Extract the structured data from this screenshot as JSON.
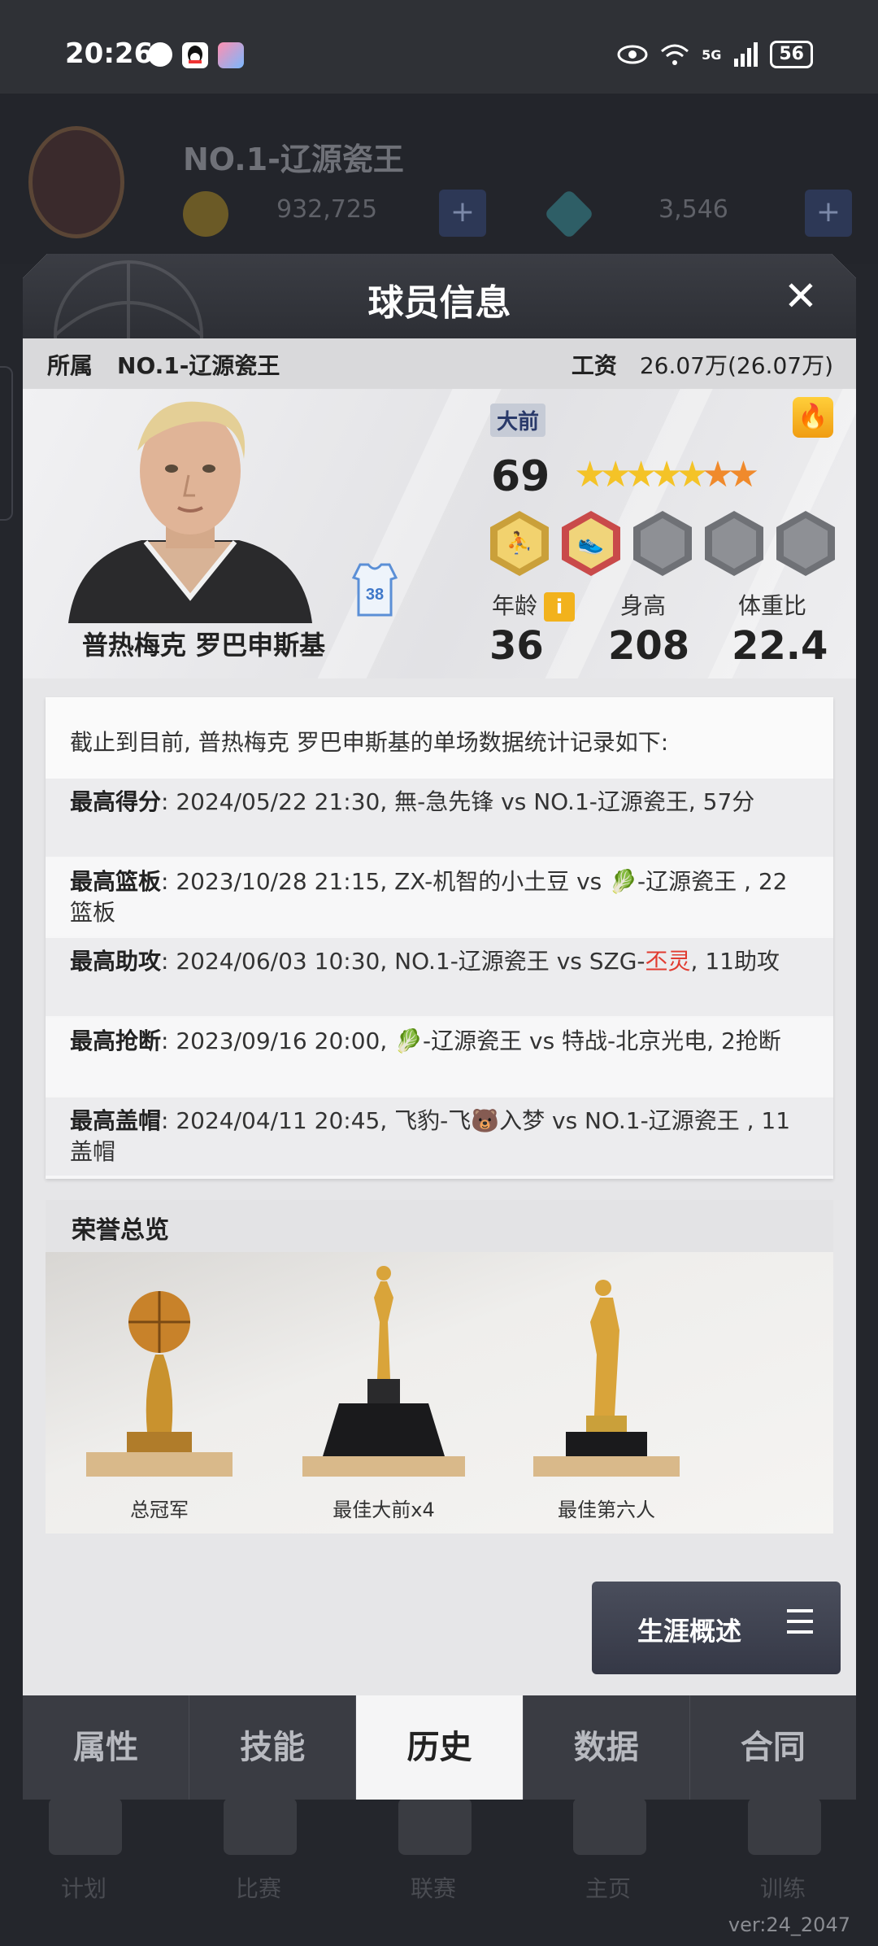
{
  "status_bar": {
    "time": "20:26",
    "network": "5G",
    "battery": "56"
  },
  "background": {
    "team_name": "NO.1-辽源瓷王",
    "coins": "932,725",
    "diamonds": "3,546",
    "version": "ver:24_2047",
    "bottom_labels": [
      "计划",
      "比赛",
      "联赛",
      "主页",
      "训练"
    ]
  },
  "modal": {
    "title": "球员信息",
    "close_icon": "close-icon",
    "affiliation_label": "所属",
    "affiliation_value": "NO.1-辽源瓷王",
    "salary_label": "工资",
    "salary_value": "26.07万(26.07万)"
  },
  "player": {
    "name": "普热梅克 罗巴申斯基",
    "jersey_number": "38",
    "position": "大前",
    "rating": "69",
    "star_count": 7,
    "star_colors": [
      "#f4c327",
      "#f4c327",
      "#f4c327",
      "#f4c327",
      "#f4c327",
      "#f08a2c",
      "#f08a2c"
    ],
    "age_label": "年龄",
    "age": "36",
    "age_info_icon": "i",
    "height_label": "身高",
    "height": "208",
    "weight_label": "体重比",
    "weight": "22.4",
    "badges": [
      "gold-player-badge",
      "red-shoe-badge",
      "locked-badge",
      "locked-badge",
      "locked-badge"
    ]
  },
  "records": {
    "intro": "截止到目前, 普热梅克 罗巴申斯基的单场数据统计记录如下:",
    "rows": [
      {
        "label": "最高得分",
        "text": ": 2024/05/22 21:30, 無-急先锋 vs NO.1-辽源瓷王, 57分"
      },
      {
        "label": "最高篮板",
        "text": ": 2023/10/28 21:15, ZX-机智的小土豆 vs 🥬-辽源瓷王 , 22篮板"
      },
      {
        "label": "最高助攻",
        "text": ": 2024/06/03 10:30, NO.1-辽源瓷王 vs SZG-",
        "red": "丕灵",
        "tail": ", 11助攻"
      },
      {
        "label": "最高抢断",
        "text": ": 2023/09/16 20:00, 🥬-辽源瓷王 vs 特战-北京光电, 2抢断"
      },
      {
        "label": "最高盖帽",
        "text": ": 2024/04/11 20:45, 飞豹-飞🐻入梦 vs NO.1-辽源瓷王 , 11盖帽"
      }
    ]
  },
  "honors": {
    "title": "荣誉总览",
    "items": [
      "总冠军",
      "最佳大前x4",
      "最佳第六人"
    ]
  },
  "career_button": "生涯概述",
  "tabs": [
    "属性",
    "技能",
    "历史",
    "数据",
    "合同"
  ],
  "active_tab": "历史"
}
